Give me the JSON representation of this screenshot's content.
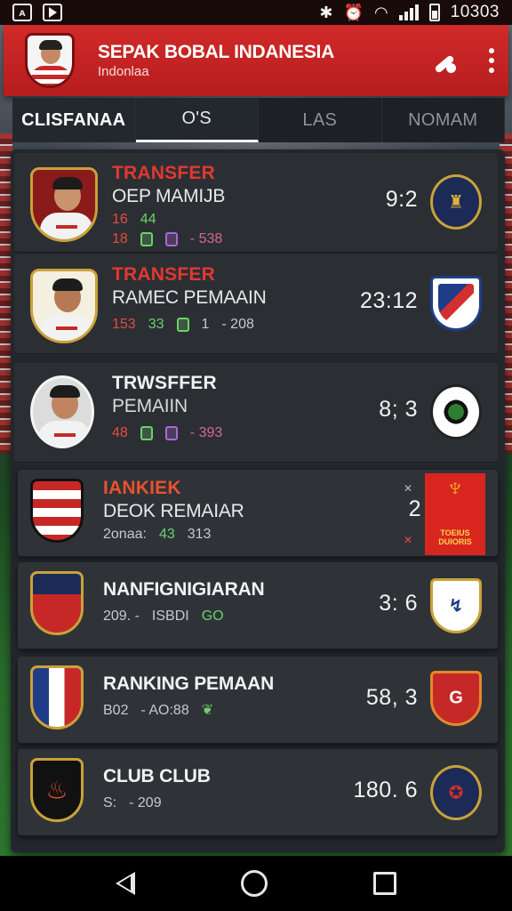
{
  "status_bar": {
    "time": "10303",
    "bluetooth_icon": "bluetooth-icon",
    "alarm_icon": "alarm-icon",
    "wifi_icon": "wifi-icon",
    "signal_icon": "signal-icon",
    "battery_icon": "battery-icon"
  },
  "app_bar": {
    "title": "SEPAK BOBAL INDANESIA",
    "subtitle": "Indonlaa"
  },
  "tabs": [
    {
      "label": "CLISFANAA"
    },
    {
      "label": "O'S"
    },
    {
      "label": "LAS"
    },
    {
      "label": "NOMAM"
    }
  ],
  "items": [
    {
      "tag": "TRANSFER",
      "name": "OEP MAMIJB",
      "meta1": "16",
      "meta2": "44",
      "meta3": "18",
      "meta4": "- 538",
      "score": "9:2"
    },
    {
      "tag": "TRANSFER",
      "name": "RAMEC PEMAAIN",
      "meta1": "153",
      "meta2": "33",
      "meta3": "1",
      "meta4": "- 208",
      "score": "23:12"
    },
    {
      "tag": "TRWSFFER",
      "name": "PEMAIIN",
      "meta1": "48",
      "meta2": "",
      "meta3": "",
      "meta4": "- 393",
      "score": "8; 3"
    },
    {
      "tag": "IANKIEK",
      "name": "DEOK REMAIAR",
      "meta1": "2onaa:",
      "meta2": "43",
      "meta3": "313",
      "meta4": "",
      "score": "2",
      "box_text": "TOEIUS DUIORIS"
    },
    {
      "tag": "",
      "name": "NANFIGNIGIARAN",
      "meta1": "209. -",
      "meta2": "ISBDI",
      "meta3": "GO",
      "meta4": "",
      "score": "3: 6"
    },
    {
      "tag": "",
      "name": "RANKING PEMAAN",
      "meta1": "B02",
      "meta2": "- AO:88",
      "meta3": "",
      "meta4": "",
      "score": "58, 3"
    },
    {
      "tag": "",
      "name": "CLUB CLUB",
      "meta1": "S:",
      "meta2": "- 209",
      "meta3": "",
      "meta4": "",
      "score": "180. 6"
    }
  ],
  "nav_bar": {
    "back_icon": "back-icon",
    "home_icon": "home-icon",
    "recent_icon": "recent-apps-icon"
  },
  "colors": {
    "accent": "#c62828",
    "card": "#2b2f34",
    "tag": "#e2382f"
  }
}
